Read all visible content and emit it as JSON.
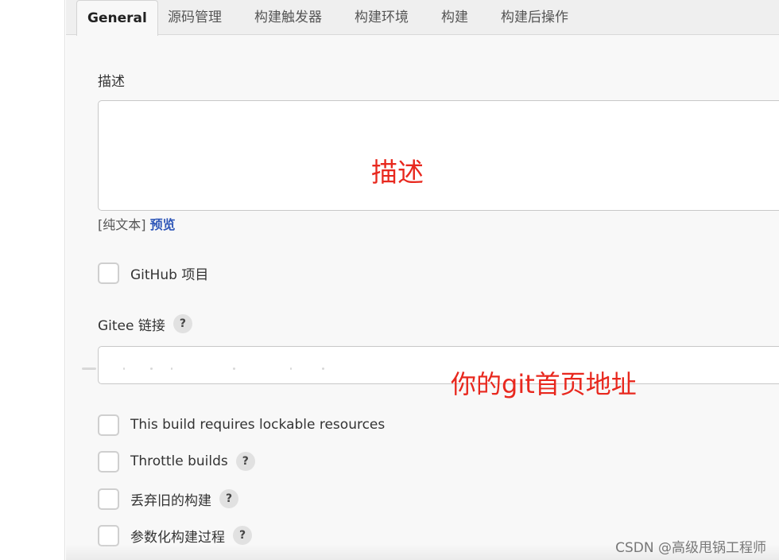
{
  "tabs": [
    {
      "label": "General",
      "active": true
    },
    {
      "label": "源码管理"
    },
    {
      "label": "构建触发器"
    },
    {
      "label": "构建环境"
    },
    {
      "label": "构建"
    },
    {
      "label": "构建后操作"
    }
  ],
  "description": {
    "label": "描述",
    "annotation": "描述",
    "format_prefix": "[纯文本]",
    "preview_label": "预览"
  },
  "github_project": {
    "label": "GitHub 项目"
  },
  "gitee": {
    "label": "Gitee 链接",
    "help": "?",
    "annotation": "你的git首页地址"
  },
  "options": [
    {
      "label": "This build requires lockable resources",
      "help": ""
    },
    {
      "label": "Throttle builds",
      "help": "?"
    },
    {
      "label": "丢弃旧的构建",
      "help": "?"
    },
    {
      "label": "参数化构建过程",
      "help": "?"
    }
  ],
  "watermark": "CSDN @高级甩锅工程师",
  "colors": {
    "annotation_red": "#e8281e",
    "link_blue": "#2f57b8"
  }
}
